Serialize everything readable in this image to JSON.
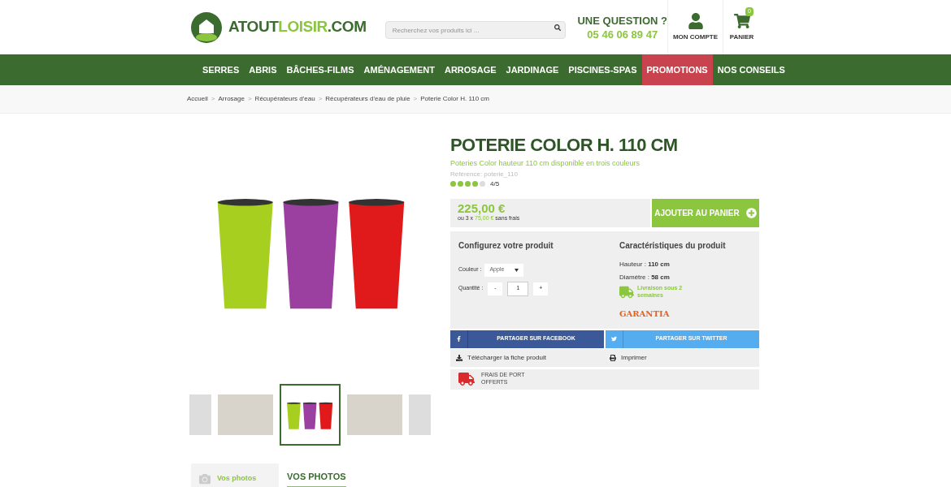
{
  "header": {
    "logo_dark": "ATOUT",
    "logo_light": "LOISIR",
    "logo_suffix": ".COM",
    "search": {
      "placeholder": "Recherchez vos produits ici ..."
    },
    "question": "UNE QUESTION ?",
    "phone": "05 46 06 89 47",
    "account": "MON COMPTE",
    "cart": "PANIER",
    "cart_count": "0"
  },
  "nav": [
    {
      "label": "SERRES",
      "selected": false
    },
    {
      "label": "ABRIS",
      "selected": false
    },
    {
      "label": "BÂCHES-FILMS",
      "selected": false
    },
    {
      "label": "AMÉNAGEMENT",
      "selected": false
    },
    {
      "label": "ARROSAGE",
      "selected": false
    },
    {
      "label": "JARDINAGE",
      "selected": false
    },
    {
      "label": "PISCINES-SPAS",
      "selected": false
    },
    {
      "label": "PROMOTIONS",
      "selected": true
    },
    {
      "label": "NOS CONSEILS",
      "selected": false
    }
  ],
  "breadcrumb_separator": ">",
  "breadcrumb": [
    "Accueil",
    "Arrosage",
    "Récupérateurs d'eau",
    "Récupérateurs d'eau de pluie",
    "Poterie Color H. 110 cm"
  ],
  "thumbnails": [
    {
      "kind": "room",
      "selected": false
    },
    {
      "kind": "room",
      "selected": false
    },
    {
      "kind": "vases",
      "selected": true
    },
    {
      "kind": "room",
      "selected": false
    },
    {
      "kind": "room",
      "selected": false
    }
  ],
  "photos_tab": {
    "label": "Vos photos",
    "heading": "VOS PHOTOS"
  },
  "product": {
    "title": "POTERIE COLOR H. 110 CM",
    "subtitle": "Poteries Color hauteur 110 cm disponible en trois couleurs",
    "reference": "Référence: poterie_110",
    "stars": 4,
    "rating": "4/5",
    "price": "225,00 €",
    "installment_prefix": "ou 3 x",
    "installment": "75,00 €",
    "installment_suffix": "sans frais",
    "add_to_cart": "AJOUTER AU PANIER"
  },
  "configure": {
    "title": "Configurez votre produit",
    "color_label": "Couleur :",
    "color_value": "Apple",
    "quantity_label": "Quantité :",
    "minus": "-",
    "quantity": "1",
    "plus": "+"
  },
  "features": {
    "title": "Caractéristiques du produit",
    "height_label": "Hauteur :",
    "height": "110 cm",
    "diameter_label": "Diamètre :",
    "diameter": "58 cm",
    "delivery": "Livraison sous 2 semaines",
    "warranty": "GARANTIA"
  },
  "share": [
    {
      "kind": "facebook",
      "label": "PARTAGER SUR FACEBOOK"
    },
    {
      "kind": "twitter",
      "label": "PARTAGER SUR TWITTER"
    }
  ],
  "actions": {
    "download": "Télécharger la fiche produit",
    "print": "Imprimer"
  },
  "shipping": "FRAIS DE PORT OFFERTS"
}
